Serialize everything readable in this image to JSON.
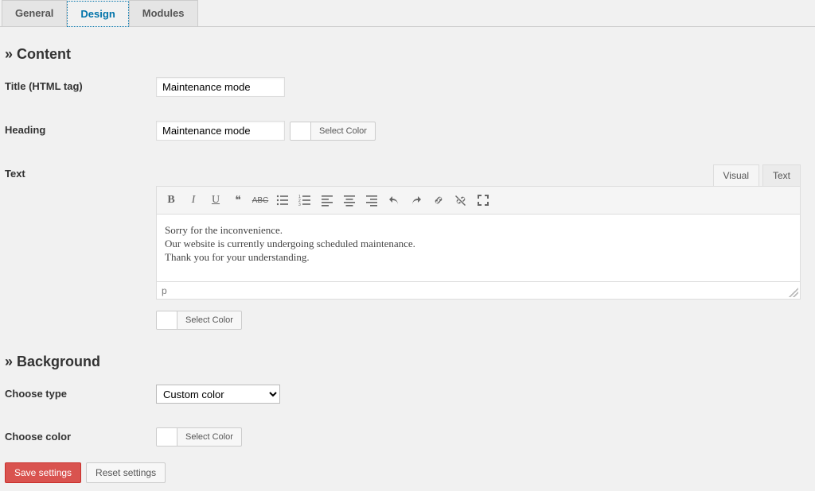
{
  "tabs": {
    "general": "General",
    "design": "Design",
    "modules": "Modules"
  },
  "sections": {
    "content_header": "» Content",
    "background_header": "» Background"
  },
  "labels": {
    "title": "Title (HTML tag)",
    "heading": "Heading",
    "text": "Text",
    "choose_type": "Choose type",
    "choose_color": "Choose color"
  },
  "inputs": {
    "title_value": "Maintenance mode",
    "heading_value": "Maintenance mode",
    "background_type": "Custom color"
  },
  "buttons": {
    "select_color": "Select Color",
    "save": "Save settings",
    "reset": "Reset settings"
  },
  "editor": {
    "visual_tab": "Visual",
    "text_tab": "Text",
    "line1": "Sorry for the inconvenience.",
    "line2": "Our website is currently undergoing scheduled maintenance.",
    "line3": "Thank you for your understanding.",
    "status_path": "p"
  }
}
